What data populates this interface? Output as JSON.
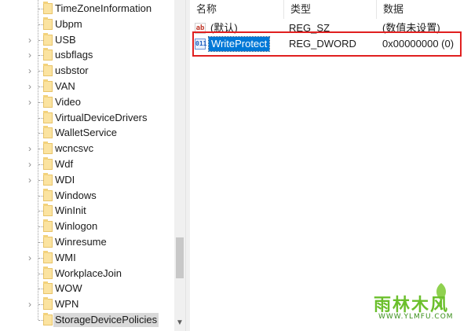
{
  "tree": {
    "items": [
      {
        "label": "TimeZoneInformation",
        "expandable": false
      },
      {
        "label": "Ubpm",
        "expandable": false
      },
      {
        "label": "USB",
        "expandable": true
      },
      {
        "label": "usbflags",
        "expandable": true
      },
      {
        "label": "usbstor",
        "expandable": true
      },
      {
        "label": "VAN",
        "expandable": true
      },
      {
        "label": "Video",
        "expandable": true
      },
      {
        "label": "VirtualDeviceDrivers",
        "expandable": false
      },
      {
        "label": "WalletService",
        "expandable": false
      },
      {
        "label": "wcncsvc",
        "expandable": true
      },
      {
        "label": "Wdf",
        "expandable": true
      },
      {
        "label": "WDI",
        "expandable": true
      },
      {
        "label": "Windows",
        "expandable": false
      },
      {
        "label": "WinInit",
        "expandable": false
      },
      {
        "label": "Winlogon",
        "expandable": false
      },
      {
        "label": "Winresume",
        "expandable": false
      },
      {
        "label": "WMI",
        "expandable": true
      },
      {
        "label": "WorkplaceJoin",
        "expandable": false
      },
      {
        "label": "WOW",
        "expandable": false
      },
      {
        "label": "WPN",
        "expandable": true
      },
      {
        "label": "StorageDevicePolicies",
        "expandable": false,
        "selected": true
      }
    ]
  },
  "list": {
    "columns": {
      "name": "名称",
      "type": "类型",
      "data": "数据"
    },
    "rows": [
      {
        "icon": "string-value-icon",
        "icon_glyph": "ab",
        "name": "(默认)",
        "type": "REG_SZ",
        "data": "(数值未设置)",
        "selected": false
      },
      {
        "icon": "dword-value-icon",
        "icon_glyph": "011",
        "name": "WriteProtect",
        "type": "REG_DWORD",
        "data": "0x00000000 (0)",
        "selected": true
      }
    ]
  },
  "watermark": {
    "text": "雨林木风",
    "url": "WWW.YLMFU.COM"
  },
  "colors": {
    "selection": "#0078d7",
    "highlight_box": "#e02020",
    "folder": "#fbe3a0"
  }
}
